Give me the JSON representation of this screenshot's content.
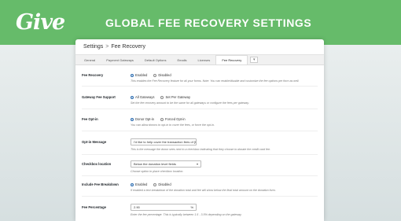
{
  "banner": {
    "logo": "Give",
    "title": "GLOBAL FEE RECOVERY SETTINGS"
  },
  "window": {
    "breadcrumb": {
      "root": "Settings",
      "separator": ">",
      "current": "Fee Recovery"
    },
    "tabs": [
      {
        "label": "General",
        "active": false
      },
      {
        "label": "Payment Gateways",
        "active": false
      },
      {
        "label": "Default Options",
        "active": false
      },
      {
        "label": "Emails",
        "active": false
      },
      {
        "label": "Licenses",
        "active": false
      },
      {
        "label": "Fee Recovery",
        "active": true
      }
    ],
    "tab_more": "▾"
  },
  "settings": {
    "fee_recovery": {
      "label": "Fee Recovery",
      "options": [
        "Enabled",
        "Disabled"
      ],
      "selected": "Enabled",
      "description": "This enables the Fee Recovery feature for all your forms. Note: You can enable/disable and customize the fee options per form as well."
    },
    "gateway_support": {
      "label": "Gateway Fee Support",
      "options": [
        "All Gateways",
        "Set Per Gateway"
      ],
      "selected": "All Gateways",
      "description": "Set the fee recovery amount to be the same for all gateways or configure the fees per gateway."
    },
    "fee_opt_in": {
      "label": "Fee Opt-in",
      "options": [
        "Donor Opt-in",
        "Forced Opt-in"
      ],
      "selected": "Donor Opt-in",
      "description": "You can allow donors to opt-in to cover the fees, or force the opt-in."
    },
    "opt_in_message": {
      "label": "Opt-in Message",
      "value": "I'd like to help cover the transaction fees of {fee_amount}",
      "description": "This is the message the donor sees next to a checkbox indicating that they choose to donate the credit card fee."
    },
    "checkbox_location": {
      "label": "Checkbox location",
      "value": "Below the donation level fields",
      "description": "Choose option to place checkbox location."
    },
    "fee_breakdown": {
      "label": "Include Fee Breakdown",
      "options": [
        "Enabled",
        "Disabled"
      ],
      "selected": "Enabled",
      "description": "If enabled a text breakdown of the donation total and fee will show below the final total amount on the donation form."
    },
    "fee_percentage": {
      "label": "Fee Percentage",
      "value": "2.90",
      "unit": "%",
      "description": "Enter the fee percentage. This is typically between 1.5 - 3.5% depending on the gateway."
    }
  },
  "colors": {
    "banner": "#66bb6a",
    "radio_selected": "#2b6cb0"
  }
}
